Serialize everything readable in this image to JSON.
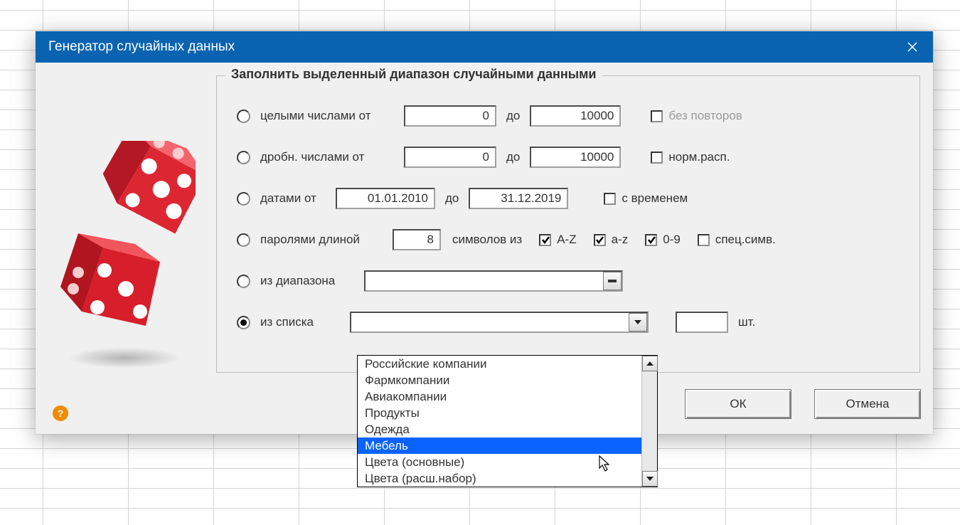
{
  "dialog_title": "Генератор случайных данных",
  "group_title": "Заполнить выделенный диапазон случайными данными",
  "rows": {
    "integers": {
      "label": "целыми числами от",
      "from": "0",
      "sep": "до",
      "to": "10000",
      "norepeats": "без повторов"
    },
    "decimals": {
      "label": "дробн. числами от",
      "from": "0",
      "sep": "до",
      "to": "10000",
      "normdist": "норм.расп."
    },
    "dates": {
      "label": "датами от",
      "from": "01.01.2010",
      "sep": "до",
      "to": "31.12.2019",
      "withtime": "с временем"
    },
    "passwords": {
      "label": "паролями длиной",
      "len": "8",
      "suffix": "символов из",
      "az_upper": "A-Z",
      "az_lower": "a-z",
      "digits": "0-9",
      "special": "спец.симв."
    },
    "range": {
      "label": "из диапазона"
    },
    "list": {
      "label": "из списка",
      "unit": "шт."
    }
  },
  "dropdown_items": [
    "Российские компании",
    "Фармкомпании",
    "Авиакомпании",
    "Продукты",
    "Одежда",
    "Мебель",
    "Цвета (основные)",
    "Цвета (расш.набор)"
  ],
  "dd_selected_index": 5,
  "ok": "ОК",
  "cancel": "Отмена",
  "help_char": "?"
}
